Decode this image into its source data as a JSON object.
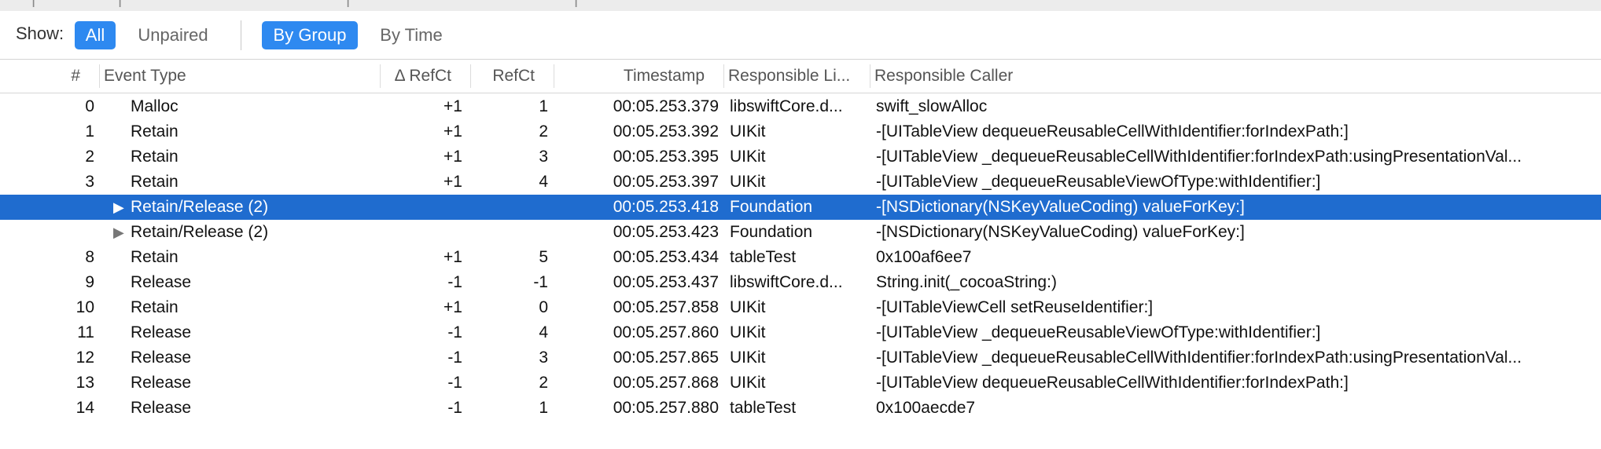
{
  "toolbar": {
    "show_label": "Show:",
    "filter_all": "All",
    "filter_unpaired": "Unpaired",
    "group_by_group": "By Group",
    "group_by_time": "By Time"
  },
  "columns": {
    "num": "#",
    "event_type": "Event Type",
    "delta_refct": "Δ RefCt",
    "refct": "RefCt",
    "timestamp": "Timestamp",
    "responsible_library": "Responsible Li...",
    "responsible_caller": "Responsible Caller"
  },
  "colors": {
    "accent": "#2e89f0",
    "selected_row": "#1f6ccf"
  },
  "rows": [
    {
      "num": "0",
      "event_type": "Malloc",
      "delta": "+1",
      "refct": "1",
      "timestamp": "00:05.253.379",
      "library": "libswiftCore.d...",
      "caller": "swift_slowAlloc"
    },
    {
      "num": "1",
      "event_type": "Retain",
      "delta": "+1",
      "refct": "2",
      "timestamp": "00:05.253.392",
      "library": "UIKit",
      "caller": "-[UITableView dequeueReusableCellWithIdentifier:forIndexPath:]"
    },
    {
      "num": "2",
      "event_type": "Retain",
      "delta": "+1",
      "refct": "3",
      "timestamp": "00:05.253.395",
      "library": "UIKit",
      "caller": "-[UITableView _dequeueReusableCellWithIdentifier:forIndexPath:usingPresentationVal..."
    },
    {
      "num": "3",
      "event_type": "Retain",
      "delta": "+1",
      "refct": "4",
      "timestamp": "00:05.253.397",
      "library": "UIKit",
      "caller": "-[UITableView _dequeueReusableViewOfType:withIdentifier:]"
    },
    {
      "num": "",
      "event_type": "Retain/Release (2)",
      "delta": "",
      "refct": "",
      "timestamp": "00:05.253.418",
      "library": "Foundation",
      "caller": "-[NSDictionary(NSKeyValueCoding) valueForKey:]",
      "group": true,
      "selected": true
    },
    {
      "num": "",
      "event_type": "Retain/Release (2)",
      "delta": "",
      "refct": "",
      "timestamp": "00:05.253.423",
      "library": "Foundation",
      "caller": "-[NSDictionary(NSKeyValueCoding) valueForKey:]",
      "group": true
    },
    {
      "num": "8",
      "event_type": "Retain",
      "delta": "+1",
      "refct": "5",
      "timestamp": "00:05.253.434",
      "library": "tableTest",
      "caller": "0x100af6ee7"
    },
    {
      "num": "9",
      "event_type": "Release",
      "delta": "-1",
      "refct": "-1",
      "timestamp": "00:05.253.437",
      "library": "libswiftCore.d...",
      "caller": "String.init(_cocoaString:)"
    },
    {
      "num": "10",
      "event_type": "Retain",
      "delta": "+1",
      "refct": "0",
      "timestamp": "00:05.257.858",
      "library": "UIKit",
      "caller": "-[UITableViewCell setReuseIdentifier:]"
    },
    {
      "num": "11",
      "event_type": "Release",
      "delta": "-1",
      "refct": "4",
      "timestamp": "00:05.257.860",
      "library": "UIKit",
      "caller": "-[UITableView _dequeueReusableViewOfType:withIdentifier:]"
    },
    {
      "num": "12",
      "event_type": "Release",
      "delta": "-1",
      "refct": "3",
      "timestamp": "00:05.257.865",
      "library": "UIKit",
      "caller": "-[UITableView _dequeueReusableCellWithIdentifier:forIndexPath:usingPresentationVal..."
    },
    {
      "num": "13",
      "event_type": "Release",
      "delta": "-1",
      "refct": "2",
      "timestamp": "00:05.257.868",
      "library": "UIKit",
      "caller": "-[UITableView dequeueReusableCellWithIdentifier:forIndexPath:]"
    },
    {
      "num": "14",
      "event_type": "Release",
      "delta": "-1",
      "refct": "1",
      "timestamp": "00:05.257.880",
      "library": "tableTest",
      "caller": "0x100aecde7"
    }
  ]
}
